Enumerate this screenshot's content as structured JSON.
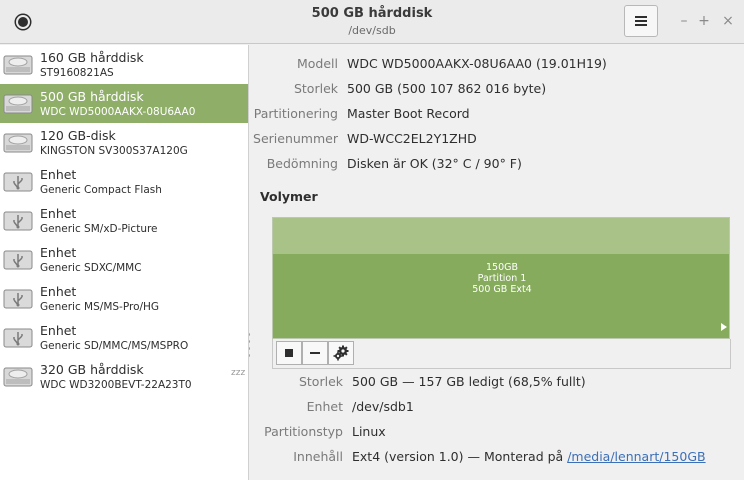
{
  "header": {
    "title": "500 GB hårddisk",
    "subtitle": "/dev/sdb",
    "menu_icon": "hamburger-icon",
    "window_controls": {
      "minimize": "–",
      "maximize": "+",
      "close": "×"
    }
  },
  "sidebar": {
    "devices": [
      {
        "name": "160 GB hårddisk",
        "sub": "ST9160821AS",
        "icon": "hard-disk-icon"
      },
      {
        "name": "500 GB hårddisk",
        "sub": "WDC WD5000AAKX-08U6AA0",
        "icon": "hard-disk-icon",
        "selected": true
      },
      {
        "name": "120 GB-disk",
        "sub": "KINGSTON SV300S37A120G",
        "icon": "hard-disk-icon"
      },
      {
        "name": "Enhet",
        "sub": "Generic Compact Flash",
        "icon": "usb-icon"
      },
      {
        "name": "Enhet",
        "sub": "Generic SM/xD-Picture",
        "icon": "usb-icon"
      },
      {
        "name": "Enhet",
        "sub": "Generic SDXC/MMC",
        "icon": "usb-icon"
      },
      {
        "name": "Enhet",
        "sub": "Generic MS/MS-Pro/HG",
        "icon": "usb-icon"
      },
      {
        "name": "Enhet",
        "sub": "Generic SD/MMC/MS/MSPRO",
        "icon": "usb-icon"
      },
      {
        "name": "320 GB hårddisk",
        "sub": "WDC WD3200BEVT-22A23T0",
        "icon": "hard-disk-icon"
      }
    ],
    "sleep_indicator": "zzz"
  },
  "disk_info": {
    "model_label": "Modell",
    "model": "WDC WD5000AAKX-08U6AA0 (19.01H19)",
    "size_label": "Storlek",
    "size": "500 GB (500 107 862 016 byte)",
    "partitioning_label": "Partitionering",
    "partitioning": "Master Boot Record",
    "serial_label": "Serienummer",
    "serial": "WD-WCC2EL2Y1ZHD",
    "assessment_label": "Bedömning",
    "assessment": "Disken är OK (32° C / 90° F)"
  },
  "volumes": {
    "heading": "Volymer",
    "partition": {
      "line1": "150GB",
      "line2": "Partition 1",
      "line3": "500 GB Ext4"
    },
    "toolbar": {
      "stop_icon": "stop-icon",
      "remove_icon": "minus-icon",
      "settings_icon": "gears-icon"
    }
  },
  "volume_info": {
    "size_label": "Storlek",
    "size": "500 GB — 157 GB ledigt (68,5% fullt)",
    "device_label": "Enhet",
    "device": "/dev/sdb1",
    "parttype_label": "Partitionstyp",
    "parttype": "Linux",
    "contents_label": "Innehåll",
    "contents_prefix": "Ext4 (version 1.0) — Monterad på ",
    "mount_link": "/media/lennart/150GB"
  },
  "colors": {
    "selection": "#8fae68",
    "partition": "#86ab5c",
    "link": "#3b6fb8"
  }
}
